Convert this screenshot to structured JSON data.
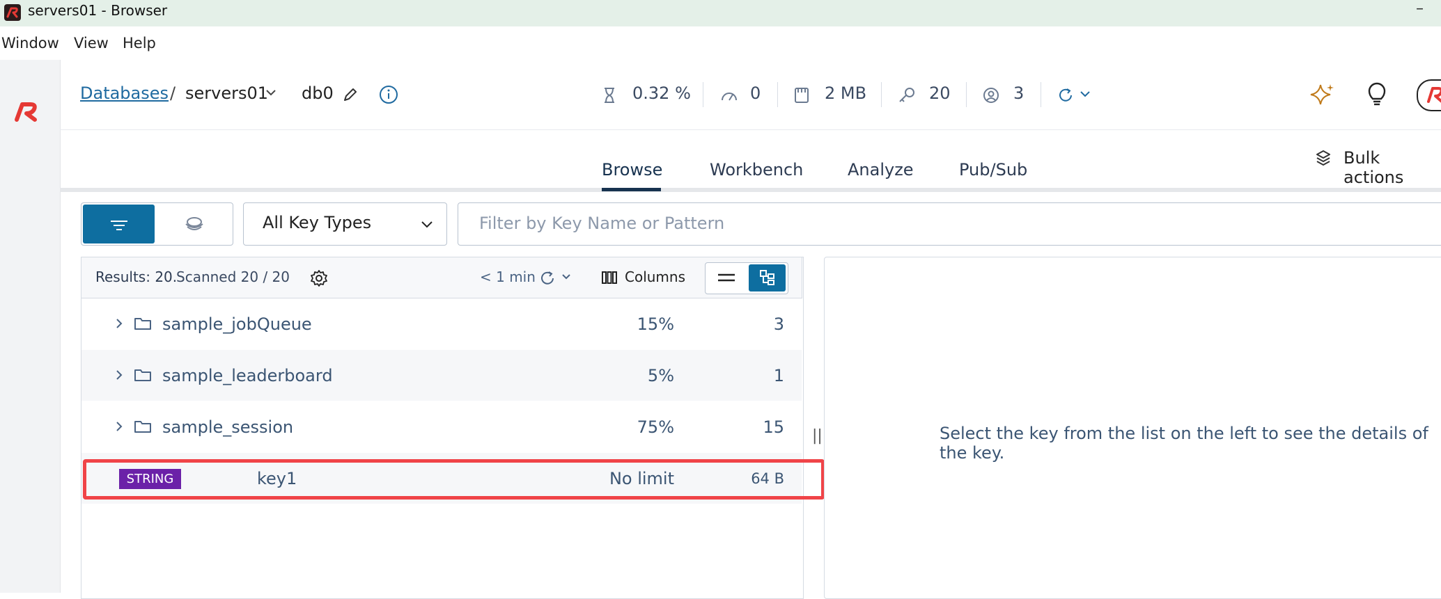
{
  "window": {
    "title": "servers01 - Browser",
    "minimize": "–"
  },
  "menu": {
    "window": "Window",
    "view": "View",
    "help": "Help"
  },
  "header": {
    "breadcrumb_root": "Databases",
    "separator": "/",
    "db_name": "servers01",
    "db_index": "db0",
    "stats": {
      "cpu": "0.32 %",
      "ops": "0",
      "memory": "2 MB",
      "keys": "20",
      "clients": "3"
    }
  },
  "tabs": [
    "Browse",
    "Workbench",
    "Analyze",
    "Pub/Sub"
  ],
  "active_tab": "Browse",
  "bulk_actions": "Bulk actions",
  "filter": {
    "key_type": "All Key Types",
    "placeholder": "Filter by Key Name or Pattern"
  },
  "list": {
    "results_label": "Results: 20.",
    "scanned": "Scanned 20 / 20",
    "last_refresh": "< 1 min",
    "columns_label": "Columns",
    "folders": [
      {
        "name": "sample_jobQueue",
        "percent": "15%",
        "count": "3"
      },
      {
        "name": "sample_leaderboard",
        "percent": "5%",
        "count": "1"
      },
      {
        "name": "sample_session",
        "percent": "75%",
        "count": "15"
      }
    ],
    "key": {
      "type": "STRING",
      "name": "key1",
      "ttl": "No limit",
      "size": "64 B"
    }
  },
  "details": {
    "empty_message": "Select the key from the list on the left to see the details of the key."
  },
  "colors": {
    "accent": "#0e6ea0",
    "string_badge": "#6b21a8",
    "highlight": "#f04448",
    "logo": "#e53935"
  }
}
